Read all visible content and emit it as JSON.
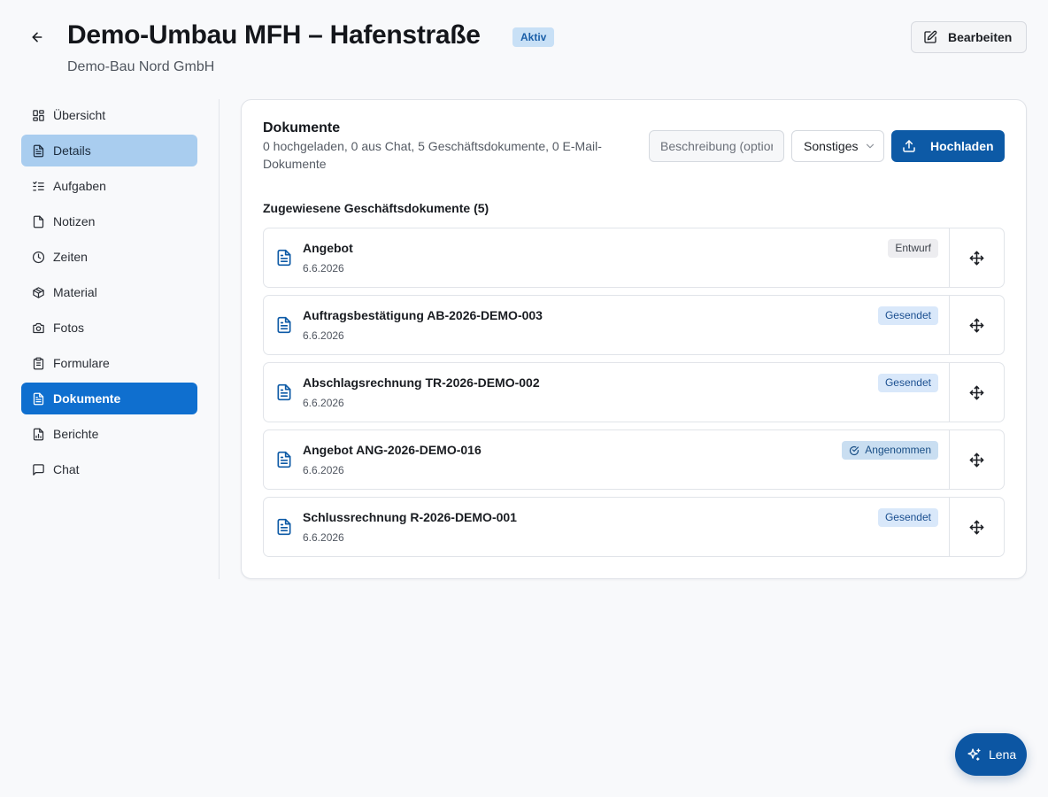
{
  "header": {
    "title": "Demo-Umbau MFH – Hafenstraße",
    "status": "Aktiv",
    "subtitle": "Demo-Bau Nord GmbH",
    "edit_label": "Bearbeiten"
  },
  "sidebar": {
    "items": [
      {
        "label": "Übersicht",
        "icon": "grid-icon"
      },
      {
        "label": "Details",
        "icon": "file-text-icon"
      },
      {
        "label": "Aufgaben",
        "icon": "list-checks-icon"
      },
      {
        "label": "Notizen",
        "icon": "note-icon"
      },
      {
        "label": "Zeiten",
        "icon": "clock-icon"
      },
      {
        "label": "Material",
        "icon": "package-icon"
      },
      {
        "label": "Fotos",
        "icon": "camera-icon"
      },
      {
        "label": "Formulare",
        "icon": "clipboard-icon"
      },
      {
        "label": "Dokumente",
        "icon": "file-text-icon"
      },
      {
        "label": "Berichte",
        "icon": "file-chart-icon"
      },
      {
        "label": "Chat",
        "icon": "message-square-icon"
      }
    ],
    "active": "Dokumente",
    "hovered": "Details"
  },
  "documents": {
    "title": "Dokumente",
    "summary": "0 hochgeladen, 0 aus Chat, 5 Geschäftsdokumente, 0 E-Mail-Dokumente",
    "description_placeholder": "Beschreibung (optional)",
    "category_value": "Sonstiges",
    "upload_label": "Hochladen",
    "assigned_heading": "Zugewiesene Geschäftsdokumente (5)",
    "items": [
      {
        "name": "Angebot",
        "date": "6.6.2026",
        "status": "Entwurf"
      },
      {
        "name": "Auftragsbestätigung AB-2026-DEMO-003",
        "date": "6.6.2026",
        "status": "Gesendet"
      },
      {
        "name": "Abschlagsrechnung TR-2026-DEMO-002",
        "date": "6.6.2026",
        "status": "Gesendet"
      },
      {
        "name": "Angebot ANG-2026-DEMO-016",
        "date": "6.6.2026",
        "status": "Angenommen"
      },
      {
        "name": "Schlussrechnung R-2026-DEMO-001",
        "date": "6.6.2026",
        "status": "Gesendet"
      }
    ]
  },
  "assistant": {
    "label": "Lena",
    "icon": "sparkles-icon"
  },
  "colors": {
    "primary": "#0d5aa6",
    "nav_active": "#0f6fcf",
    "nav_hover": "#a9cdef",
    "badge_active_bg": "#c8e0f6",
    "background": "#f8f9fb"
  }
}
